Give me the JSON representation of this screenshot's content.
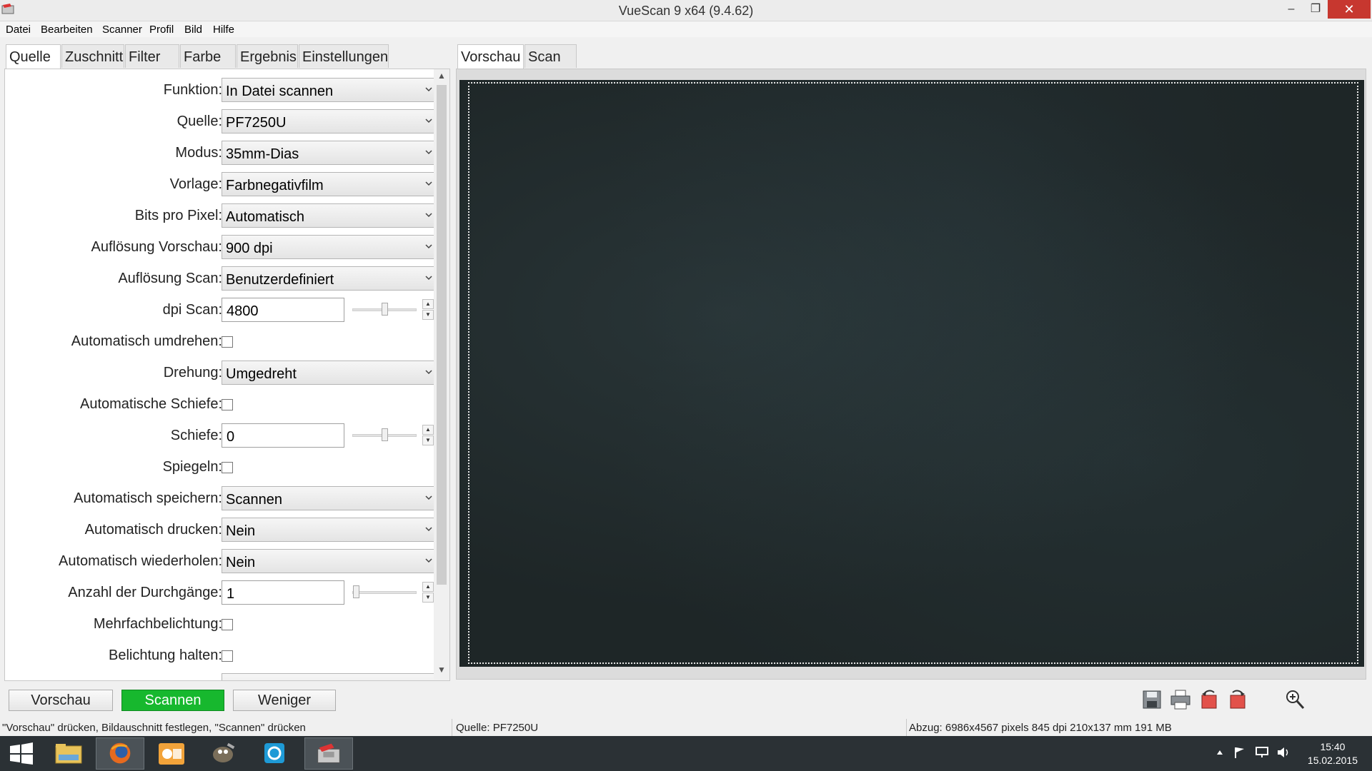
{
  "window": {
    "title": "VueScan 9 x64 (9.4.62)",
    "minimize": "–",
    "maximize": "❐",
    "close": "✕"
  },
  "menu": [
    "Datei",
    "Bearbeiten",
    "Scanner",
    "Profil",
    "Bild",
    "Hilfe"
  ],
  "left_tabs": [
    "Quelle",
    "Zuschnitt",
    "Filter",
    "Farbe",
    "Ergebnis",
    "Einstellungen"
  ],
  "right_tabs": [
    "Vorschau",
    "Scan"
  ],
  "form": {
    "funktion": {
      "label": "Funktion:",
      "value": "In Datei scannen"
    },
    "quelle": {
      "label": "Quelle:",
      "value": "PF7250U"
    },
    "modus": {
      "label": "Modus:",
      "value": "35mm-Dias"
    },
    "vorlage": {
      "label": "Vorlage:",
      "value": "Farbnegativfilm"
    },
    "bits": {
      "label": "Bits pro Pixel:",
      "value": "Automatisch"
    },
    "aufl_vorschau": {
      "label": "Auflösung Vorschau:",
      "value": "900 dpi"
    },
    "aufl_scan": {
      "label": "Auflösung Scan:",
      "value": "Benutzerdefiniert"
    },
    "dpi_scan": {
      "label": "dpi Scan:",
      "value": "4800",
      "slider_fraction": 0.5
    },
    "auto_umdrehen": {
      "label": "Automatisch umdrehen:",
      "checked": false
    },
    "drehung": {
      "label": "Drehung:",
      "value": "Umgedreht"
    },
    "auto_schiefe": {
      "label": "Automatische Schiefe:",
      "checked": false
    },
    "schiefe": {
      "label": "Schiefe:",
      "value": "0",
      "slider_fraction": 0.5
    },
    "spiegeln": {
      "label": "Spiegeln:",
      "checked": false
    },
    "auto_speichern": {
      "label": "Automatisch speichern:",
      "value": "Scannen"
    },
    "auto_drucken": {
      "label": "Automatisch drucken:",
      "value": "Nein"
    },
    "auto_wiederholen": {
      "label": "Automatisch wiederholen:",
      "value": "Nein"
    },
    "durchgaenge": {
      "label": "Anzahl der Durchgänge:",
      "value": "1",
      "slider_fraction": 0.0
    },
    "mehrfach": {
      "label": "Mehrfachbelichtung:",
      "checked": false
    },
    "belichtung": {
      "label": "Belichtung halten:",
      "checked": false
    }
  },
  "buttons": {
    "vorschau": "Vorschau",
    "scannen": "Scannen",
    "weniger": "Weniger"
  },
  "toolbar_icons": [
    "save-icon",
    "print-icon",
    "rotate-left-icon",
    "rotate-right-icon",
    "zoom-in-icon"
  ],
  "status": {
    "hint": "\"Vorschau\" drücken, Bildauschnitt festlegen, \"Scannen\" drücken",
    "source": "Quelle: PF7250U",
    "output": "Abzug: 6986x4567 pixels 845 dpi 210x137 mm 191 MB"
  },
  "taskbar": {
    "items": [
      "windows-start-icon",
      "file-explorer-icon",
      "firefox-icon",
      "outlook-icon",
      "gimp-icon",
      "app-icon",
      "vuescan-icon"
    ],
    "time": "15:40",
    "date": "15.02.2015"
  },
  "colors": {
    "scan_button": "#17b82e",
    "preview_bg": "#1e2627",
    "taskbar": "#2b3135"
  }
}
